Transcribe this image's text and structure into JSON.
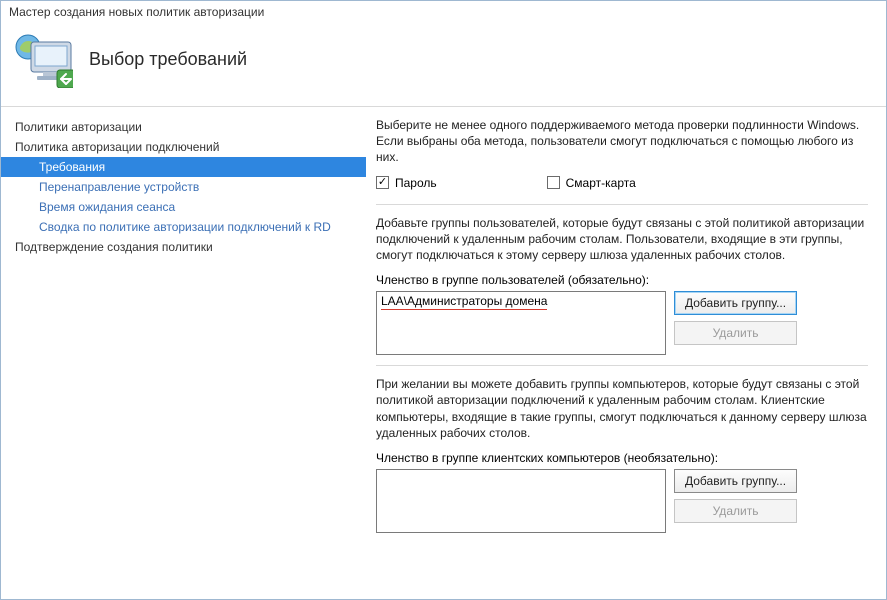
{
  "window": {
    "title": "Мастер создания новых политик авторизации"
  },
  "header": {
    "page_title": "Выбор требований"
  },
  "nav": {
    "items": [
      {
        "label": "Политики авторизации",
        "level": 0
      },
      {
        "label": "Политика авторизации подключений",
        "level": 0
      },
      {
        "label": "Требования",
        "level": 1,
        "selected": true
      },
      {
        "label": "Перенаправление устройств",
        "level": 1
      },
      {
        "label": "Время ожидания сеанса",
        "level": 1
      },
      {
        "label": "Сводка по политике авторизации подключений к RD",
        "level": 1
      },
      {
        "label": "Подтверждение создания политики",
        "level": 0
      }
    ]
  },
  "content": {
    "intro": "Выберите не менее одного поддерживаемого метода проверки подлинности Windows. Если выбраны оба метода, пользователи смогут подключаться с помощью любого из них.",
    "checks": {
      "password": {
        "label": "Пароль",
        "checked": true
      },
      "smartcard": {
        "label": "Смарт-карта",
        "checked": false
      }
    },
    "user_groups": {
      "desc": "Добавьте группы пользователей, которые будут связаны с этой политикой авторизации подключений к удаленным рабочим столам. Пользователи, входящие в эти группы, смогут подключаться к этому серверу шлюза удаленных рабочих столов.",
      "label": "Членство в группе пользователей (обязательно):",
      "entry": "LAA\\Администраторы домена",
      "add_label": "Добавить группу...",
      "remove_label": "Удалить"
    },
    "client_groups": {
      "desc": "При желании вы можете добавить группы компьютеров, которые будут связаны с этой политикой авторизации подключений к удаленным рабочим столам. Клиентские компьютеры, входящие в такие группы, смогут подключаться к данному серверу шлюза удаленных рабочих столов.",
      "label": "Членство в группе клиентских компьютеров (необязательно):",
      "add_label": "Добавить группу...",
      "remove_label": "Удалить"
    }
  }
}
